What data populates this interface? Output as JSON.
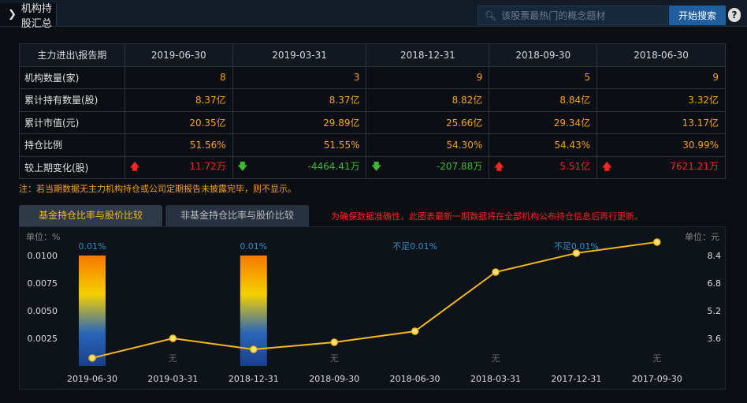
{
  "header": {
    "title": "机构持股汇总",
    "search_placeholder": "该股票最热门的概念题材",
    "search_button": "开始搜索",
    "help": "?"
  },
  "table": {
    "headers": [
      "主力进出\\报告期",
      "2019-06-30",
      "2019-03-31",
      "2018-12-31",
      "2018-09-30",
      "2018-06-30"
    ],
    "rows": [
      {
        "label": "机构数量(家)",
        "cells": [
          "8",
          "3",
          "9",
          "5",
          "9"
        ]
      },
      {
        "label": "累计持有数量(股)",
        "cells": [
          "8.37亿",
          "8.37亿",
          "8.82亿",
          "8.84亿",
          "3.32亿"
        ]
      },
      {
        "label": "累计市值(元)",
        "cells": [
          "20.35亿",
          "29.89亿",
          "25.66亿",
          "29.34亿",
          "13.17亿"
        ]
      },
      {
        "label": "持仓比例",
        "cells": [
          "51.56%",
          "51.55%",
          "54.30%",
          "54.43%",
          "30.99%"
        ]
      },
      {
        "label": "较上期变化(股)",
        "cells": [
          "11.72万",
          "-4464.41万",
          "-207.88万",
          "5.51亿",
          "7621.21万"
        ],
        "dirs": [
          "up",
          "down",
          "down",
          "up",
          "up"
        ]
      }
    ]
  },
  "note": "注：若当期数据无主力机构持仓或公司定期报告未披露完毕，则不显示。",
  "tabs": [
    {
      "label": "基金持仓比率与股价比较"
    },
    {
      "label": "非基金持仓比率与股价比较"
    }
  ],
  "warning": "为确保数据准确性，此图表最新一期数据将在全部机构公布持仓信息后再行更新。",
  "chart_data": {
    "type": "bar+line",
    "categories": [
      "2019-06-30",
      "2019-03-31",
      "2018-12-31",
      "2018-09-30",
      "2018-06-30",
      "2018-03-31",
      "2017-12-31",
      "2017-09-30"
    ],
    "bar_series": {
      "name": "基金持仓比率",
      "values": [
        0.01,
        null,
        0.01,
        null,
        0,
        null,
        0,
        null
      ],
      "labels": [
        "0.01%",
        "无",
        "0.01%",
        "无",
        "不足0.01%",
        "无",
        "不足0.01%",
        "无"
      ]
    },
    "line_series": {
      "name": "股价",
      "values": [
        2.46,
        3.6,
        2.96,
        3.37,
        4.01,
        7.44,
        8.54,
        9.18
      ]
    },
    "left_axis": {
      "label": "单位：%",
      "ticks": [
        "0.0100",
        "0.0075",
        "0.0050",
        "0.0025"
      ],
      "range": [
        0,
        0.01
      ]
    },
    "right_axis": {
      "label": "单位：元",
      "ticks": [
        "8.4",
        "6.8",
        "5.2",
        "3.6"
      ],
      "range": [
        2.0,
        8.4
      ]
    },
    "colors": {
      "line": "#f5b81d",
      "bar_top": "#f57a00",
      "bar_mid": "#f5d000",
      "bar_bottom": "#1a3f8a",
      "label": "#2d8fc4"
    }
  }
}
